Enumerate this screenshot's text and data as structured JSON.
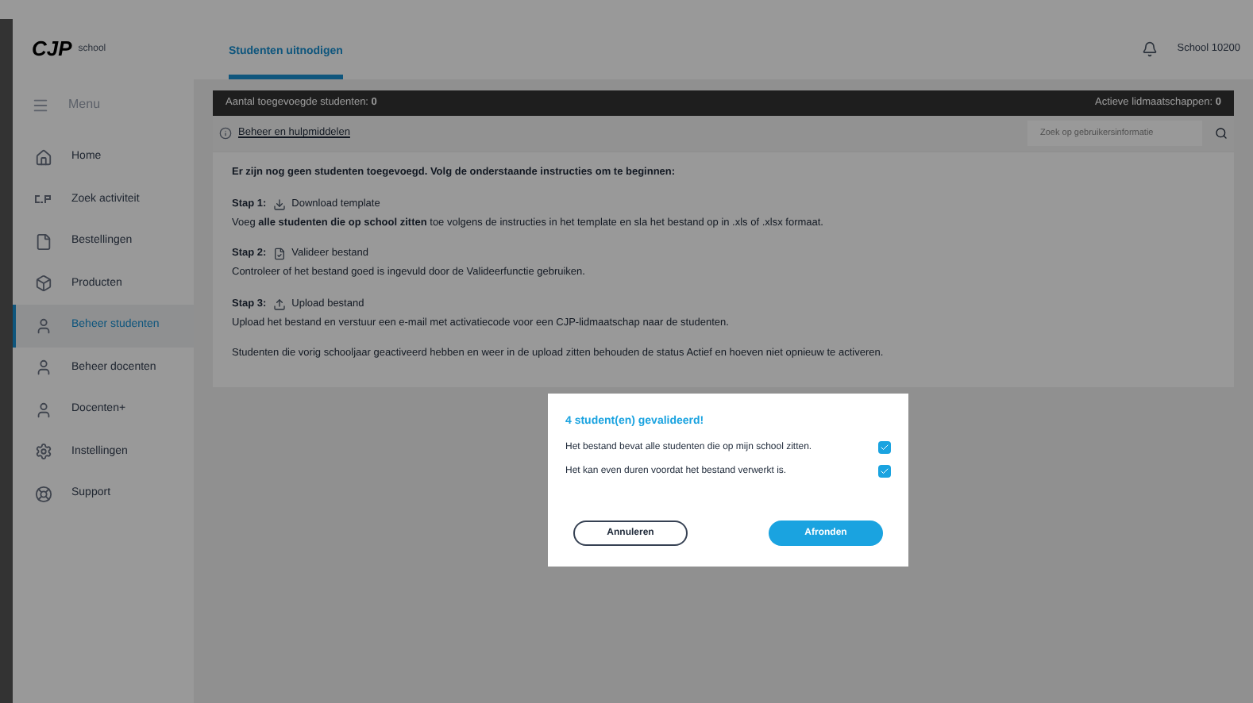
{
  "brand": {
    "logo": "CJP",
    "sub": "school"
  },
  "menu": {
    "label": "Menu"
  },
  "sidebar": {
    "items": [
      {
        "label": "Home",
        "selected": false
      },
      {
        "label": "Zoek activiteit",
        "selected": false
      },
      {
        "label": "Bestellingen",
        "selected": false
      },
      {
        "label": "Producten",
        "selected": false
      },
      {
        "label": "Beheer studenten",
        "selected": true
      },
      {
        "label": "Beheer docenten",
        "selected": false
      },
      {
        "label": "Docenten+",
        "selected": false
      },
      {
        "label": "Instellingen",
        "selected": false
      },
      {
        "label": "Support",
        "selected": false
      }
    ]
  },
  "header": {
    "tabs": [
      {
        "label": "Studenten uitnodigen",
        "selected": true
      }
    ],
    "account": "School 10200"
  },
  "stats_bar": {
    "left": "Aantal toegevoegde studenten: **0**",
    "right": "Actieve lidmaatschappen: **0**"
  },
  "toolbar": {
    "link": "Beheer en hulpmiddelen",
    "search": {
      "placeholder": "Zoek op gebruikersinformatie"
    }
  },
  "instructions": {
    "intro": "Er zijn nog geen studenten toegevoegd. Volg de onderstaande instructies om te beginnen:",
    "steps": [
      {
        "label": "Stap 1:",
        "action": "Download template",
        "text": "Voeg **alle studenten die op school zitten** toe volgens de instructies in het template en sla het bestand op in .xls of .xlsx formaat."
      },
      {
        "label": "Stap 2:",
        "action": "Valideer bestand",
        "text": "Controleer of het bestand goed is ingevuld door de Valideerfunctie gebruiken."
      },
      {
        "label": "Stap 3:",
        "action": "Upload bestand",
        "text": "Upload het bestand en verstuur een e-mail met activatiecode voor een CJP-lidmaatschap naar de studenten."
      }
    ],
    "note": "Studenten die vorig schooljaar geactiveerd hebben en weer in de upload zitten behouden de status Actief en hoeven niet opnieuw te activeren."
  },
  "dialog": {
    "title": "4 student(en) gevalideerd!",
    "checks": [
      {
        "label": "Het bestand bevat alle studenten die op mijn school zitten.",
        "checked": true
      },
      {
        "label": "Het kan even duren voordat het bestand verwerkt is.",
        "checked": true
      }
    ],
    "buttons": [
      {
        "label": "Annuleren",
        "kind": "secondary"
      },
      {
        "label": "Afronden",
        "kind": "primary"
      }
    ]
  }
}
